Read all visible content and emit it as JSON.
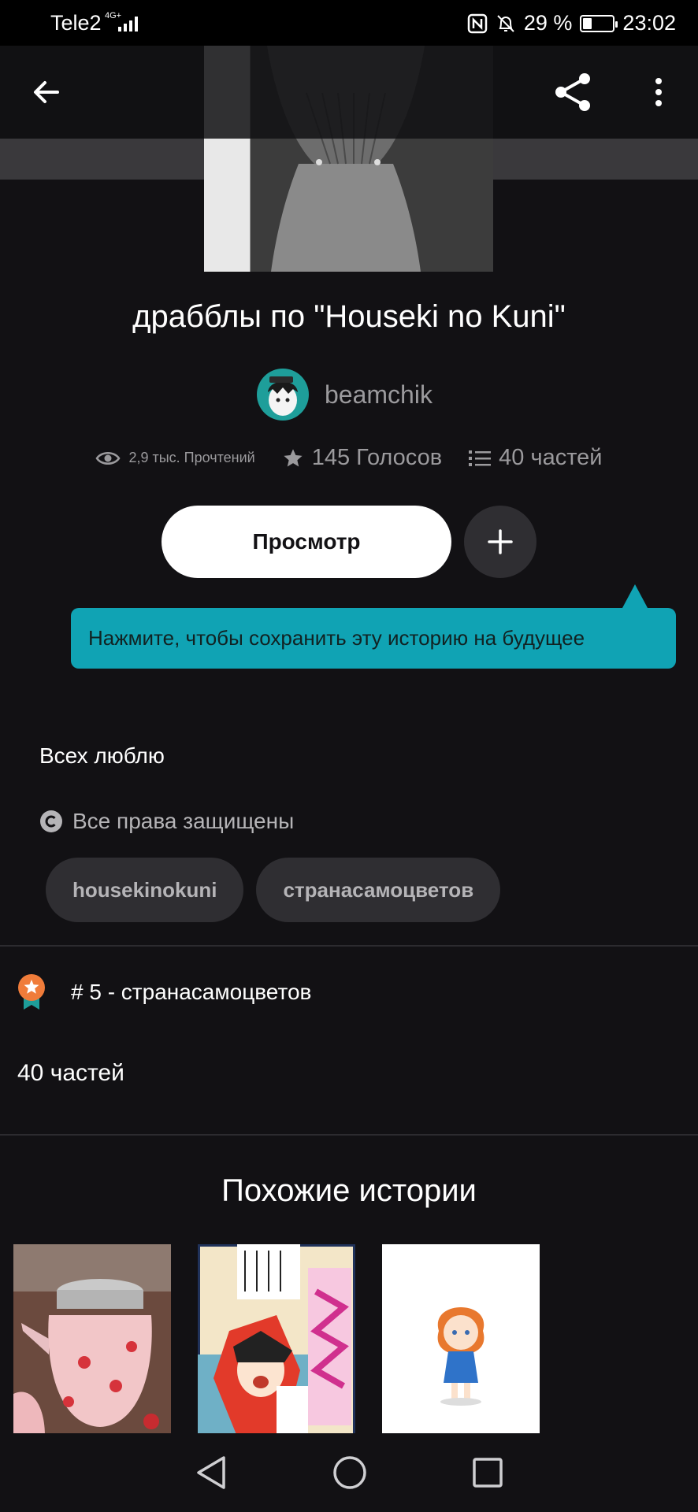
{
  "status_bar": {
    "carrier": "Tele2",
    "network": "4G+",
    "battery": "29 %",
    "battery_level": 0.29,
    "time": "23:02"
  },
  "header": {
    "back_icon": "arrow-left-icon",
    "share_icon": "share-icon",
    "more_icon": "more-vertical-icon"
  },
  "story": {
    "title": "драбблы по \"Houseki no Kuni\"",
    "author": "beamchik",
    "reads": "2,9 тыс. Прочтений",
    "votes": "145 Голосов",
    "parts": "40 частей",
    "view_button": "Просмотр",
    "add_icon": "plus-icon",
    "tooltip": "Нажмите, чтобы сохранить эту историю на будущее",
    "description": "Всех люблю",
    "copyright": "Все права защищены",
    "tags": [
      "housekinokuni",
      "странасамоцветов"
    ],
    "rank": "# 5 - странасамоцветов",
    "parts_heading": "40 частей"
  },
  "similar": {
    "title": "Похожие истории"
  },
  "colors": {
    "background": "#121114",
    "accent": "#10a3b4",
    "chip": "#2f2e32",
    "rank_badge": "#f07c3a"
  }
}
